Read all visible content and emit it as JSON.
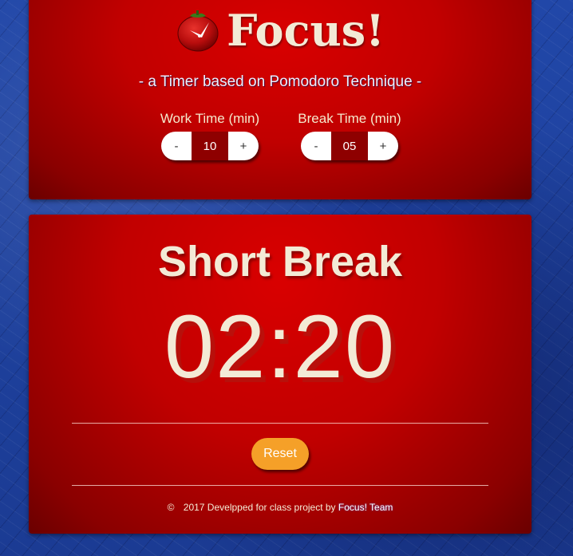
{
  "header": {
    "app_title": "Focus!",
    "subtitle": "- a Timer based on Pomodoro Technique -",
    "logo_icon": "tomato-clock-icon"
  },
  "settings": {
    "work": {
      "label": "Work Time (min)",
      "minus": "-",
      "value": "10",
      "plus": "+"
    },
    "break": {
      "label": "Break Time (min)",
      "minus": "-",
      "value": "05",
      "plus": "+"
    }
  },
  "timer": {
    "mode": "Short Break",
    "display": "02:20"
  },
  "controls": {
    "reset_label": "Reset"
  },
  "footer": {
    "copyright_symbol": "©",
    "text": "2017 Develpped for class project by",
    "team": "Focus! Team"
  },
  "colors": {
    "panel_red": "#c10000",
    "cream_text": "#f3ead6",
    "reset_orange": "#f5a028",
    "stepper_value_bg": "#8e0000",
    "background_blue": "#1e3f9a"
  }
}
